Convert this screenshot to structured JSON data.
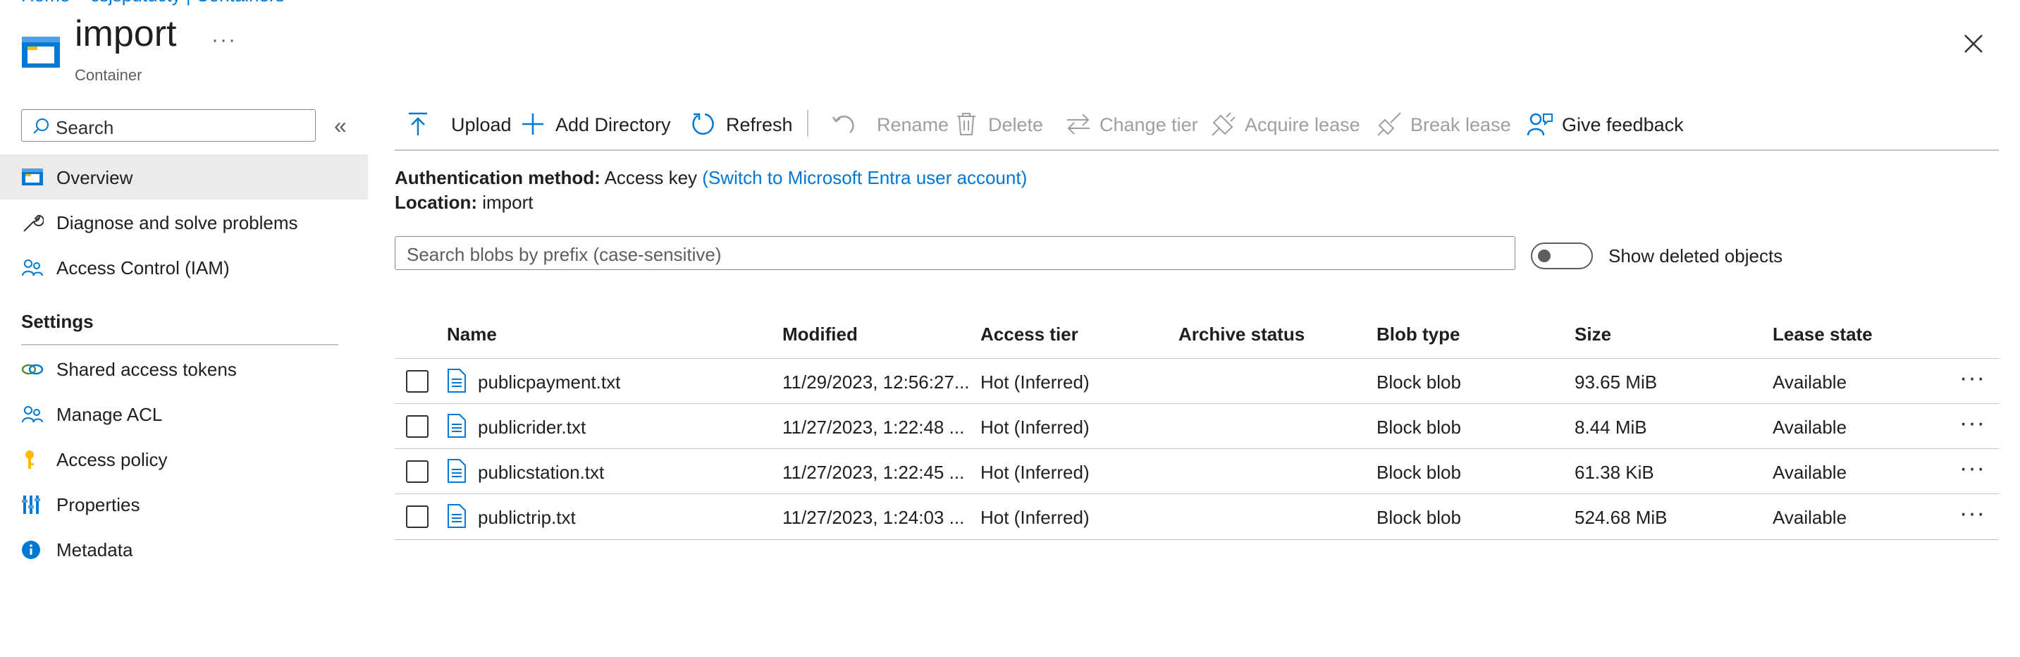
{
  "breadcrumb": [
    "Home",
    "csjsputdcty | Containers"
  ],
  "header": {
    "title": "import",
    "subtitle": "Container",
    "more": "···"
  },
  "sidebar": {
    "search_placeholder": "Search",
    "collapse": "«",
    "items": [
      {
        "label": "Overview",
        "icon": "container-icon",
        "active": true
      },
      {
        "label": "Diagnose and solve problems",
        "icon": "wrench-icon"
      },
      {
        "label": "Access Control (IAM)",
        "icon": "people-icon"
      }
    ],
    "settings_heading": "Settings",
    "settings_items": [
      {
        "label": "Shared access tokens",
        "icon": "link-icon"
      },
      {
        "label": "Manage ACL",
        "icon": "people-icon"
      },
      {
        "label": "Access policy",
        "icon": "key-icon"
      },
      {
        "label": "Properties",
        "icon": "properties-icon"
      },
      {
        "label": "Metadata",
        "icon": "info-icon"
      }
    ]
  },
  "toolbar": {
    "upload": "Upload",
    "add_directory": "Add Directory",
    "refresh": "Refresh",
    "rename": "Rename",
    "delete": "Delete",
    "change_tier": "Change tier",
    "acquire_lease": "Acquire lease",
    "break_lease": "Break lease",
    "give_feedback": "Give feedback"
  },
  "info": {
    "auth_label": "Authentication method:",
    "auth_value": "Access key",
    "auth_link": "(Switch to Microsoft Entra user account)",
    "location_label": "Location:",
    "location_value": "import"
  },
  "blob_search_placeholder": "Search blobs by prefix (case-sensitive)",
  "show_deleted_label": "Show deleted objects",
  "show_deleted_on": false,
  "table": {
    "columns": [
      "Name",
      "Modified",
      "Access tier",
      "Archive status",
      "Blob type",
      "Size",
      "Lease state"
    ],
    "rows": [
      {
        "name": "publicpayment.txt",
        "modified": "11/29/2023, 12:56:27...",
        "tier": "Hot (Inferred)",
        "archive": "",
        "type": "Block blob",
        "size": "93.65 MiB",
        "lease": "Available",
        "more": "···"
      },
      {
        "name": "publicrider.txt",
        "modified": "11/27/2023, 1:22:48 ...",
        "tier": "Hot (Inferred)",
        "archive": "",
        "type": "Block blob",
        "size": "8.44 MiB",
        "lease": "Available",
        "more": "···"
      },
      {
        "name": "publicstation.txt",
        "modified": "11/27/2023, 1:22:45 ...",
        "tier": "Hot (Inferred)",
        "archive": "",
        "type": "Block blob",
        "size": "61.38 KiB",
        "lease": "Available",
        "more": "···"
      },
      {
        "name": "publictrip.txt",
        "modified": "11/27/2023, 1:24:03 ...",
        "tier": "Hot (Inferred)",
        "archive": "",
        "type": "Block blob",
        "size": "524.68 MiB",
        "lease": "Available",
        "more": "···"
      }
    ]
  },
  "colors": {
    "accent": "#0078d4",
    "text": "#201f1e",
    "disabled": "#a19f9d",
    "active_nav": "#edebe9"
  }
}
